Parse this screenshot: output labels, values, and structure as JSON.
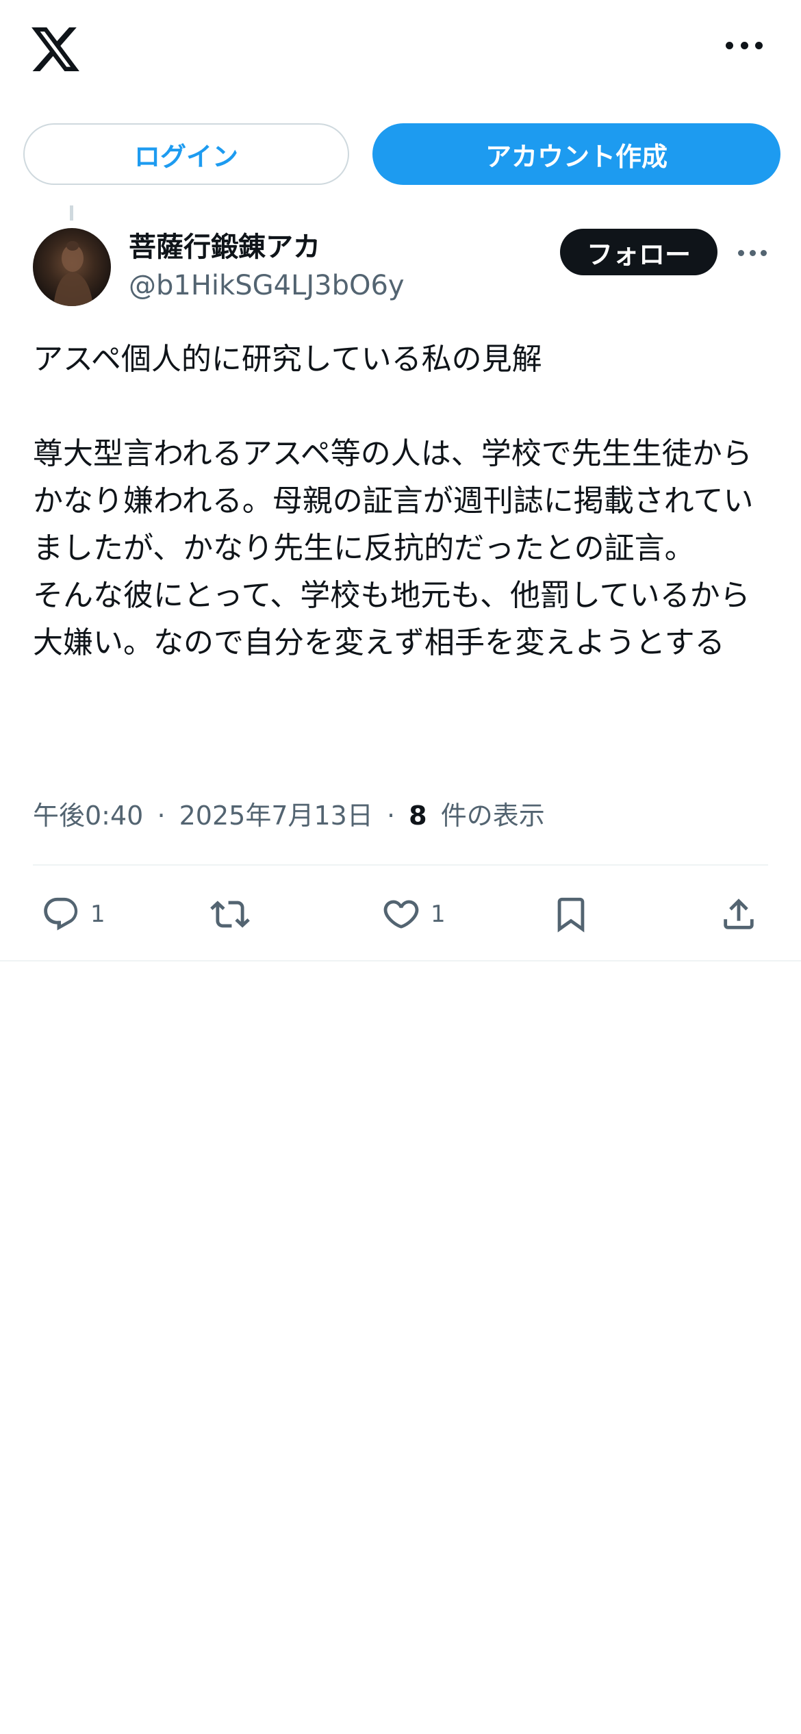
{
  "header": {
    "logo_icon": "x-logo-icon",
    "more_icon": "more-horizontal-icon"
  },
  "auth": {
    "login_label": "ログイン",
    "signup_label": "アカウント作成"
  },
  "post": {
    "author": {
      "display_name": "菩薩行鍛錬アカ",
      "handle": "@b1HikSG4LJ3bO6y"
    },
    "follow_label": "フォロー",
    "paragraphs": [
      "アスペ個人的に研究している私の見解",
      "尊大型言われるアスペ等の人は、学校で先生生徒からかなり嫌われる。母親の証言が週刊誌に掲載されていましたが、かなり先生に反抗的だったとの証言。\nそんな彼にとって、学校も地元も、他罰しているから大嫌い。なので自分を変えず相手を変えようとする"
    ],
    "meta": {
      "time": "午後0:40",
      "date": "2025年7月13日",
      "separator": "·",
      "views_count": "8",
      "views_label": "件の表示"
    },
    "actions": {
      "reply_count": "1",
      "like_count": "1"
    }
  },
  "colors": {
    "accent": "#1d9bf0",
    "text": "#0f1419",
    "secondary": "#536471",
    "border": "#cfd9de"
  }
}
